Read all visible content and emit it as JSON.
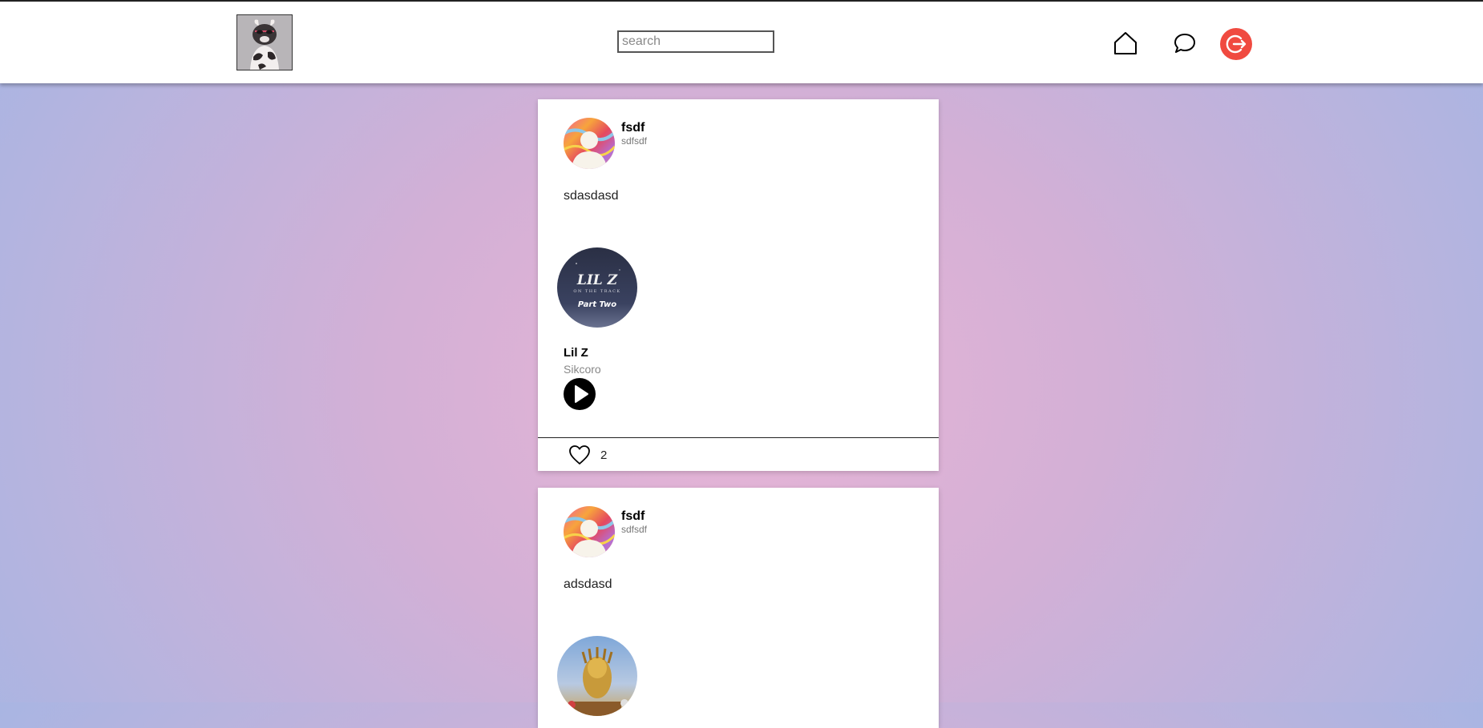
{
  "header": {
    "search_placeholder": "search"
  },
  "posts": [
    {
      "user_name": "fsdf",
      "user_handle": "sdfsdf",
      "text": "sdasdasd",
      "song": {
        "title": "Lil Z",
        "artist": "Sikcoro",
        "cover_text_main": "LIL Z",
        "cover_text_sub": "ON THE TRACK",
        "cover_text_part": "Part Two"
      },
      "likes": "2"
    },
    {
      "user_name": "fsdf",
      "user_handle": "sdfsdf",
      "text": "adsdasd"
    }
  ],
  "colors": {
    "logout": "#f04a40",
    "header_bg": "#ffffff"
  },
  "icons": [
    "home-icon",
    "chat-bubble-icon",
    "logout-icon",
    "play-icon",
    "heart-icon"
  ]
}
